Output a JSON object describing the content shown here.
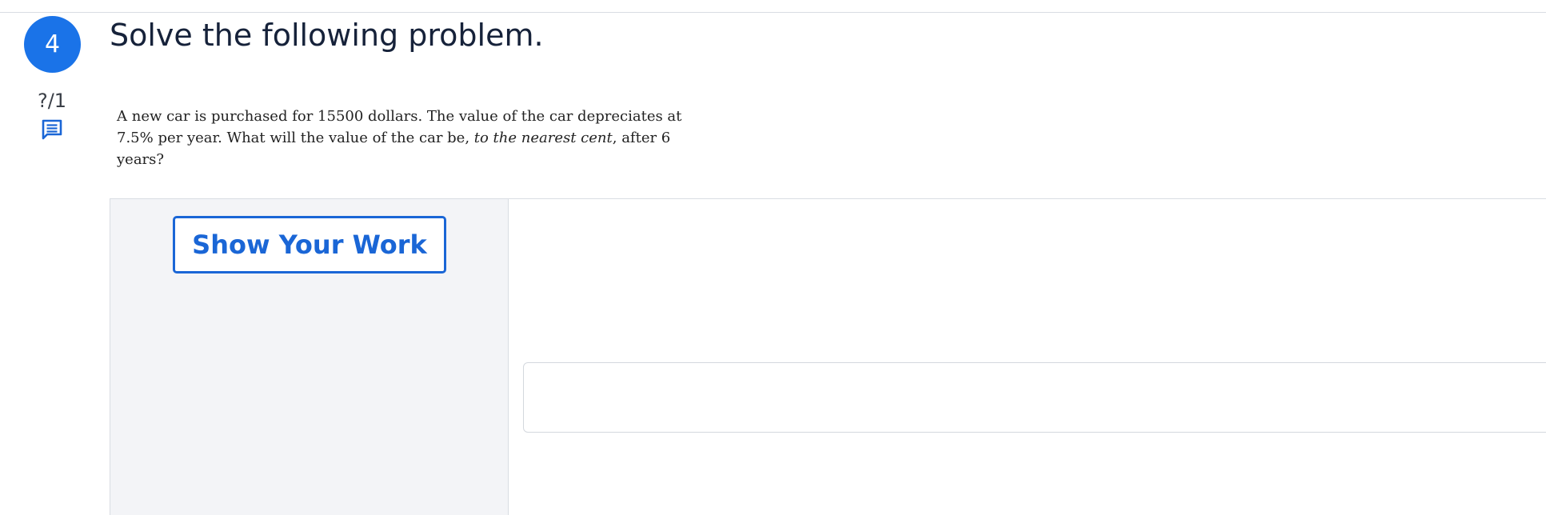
{
  "question": {
    "number": "4",
    "title": "Solve the following problem.",
    "score": "?/1",
    "comment_icon": "comment-icon",
    "problem": {
      "part1": "A new car is purchased for 15500 dollars. The value of the car depreciates at 7.5% per year. What will the value of the car be, ",
      "emphasis": "to the nearest cent",
      "part2": ", after 6 years?"
    }
  },
  "work": {
    "show_work_label": "Show Your Work"
  },
  "answer": {
    "value": "",
    "placeholder": ""
  },
  "colors": {
    "accent": "#1a73e8",
    "button_text": "#1a66d6",
    "side_panel": "#f3f4f7"
  }
}
